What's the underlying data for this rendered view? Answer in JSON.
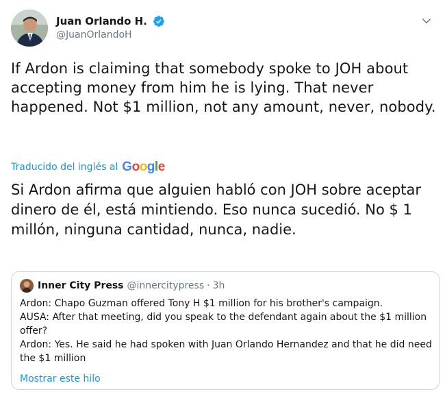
{
  "author": {
    "display_name": "Juan Orlando H.",
    "handle": "@JuanOrlandoH",
    "verified_icon": "verified-badge-icon"
  },
  "tweet": {
    "text": "If Ardon is claiming that somebody spoke to JOH about accepting money from him he is lying. That never happened. Not $1 million, not any amount, never, nobody."
  },
  "translation": {
    "label": "Traducido del inglés al",
    "provider": [
      "G",
      "o",
      "o",
      "g",
      "l",
      "e"
    ],
    "provider_colors": [
      "#4285F4",
      "#EA4335",
      "#FBBC05",
      "#4285F4",
      "#34A853",
      "#EA4335"
    ],
    "text": "Si Ardon afirma que alguien habló con JOH sobre aceptar dinero de él, está mintiendo. Eso nunca sucedió. No $ 1 millón, ninguna cantidad, nunca, nadie."
  },
  "quoted_tweet": {
    "display_name": "Inner City Press",
    "handle": "@innercitypress",
    "separator": "·",
    "time": "3h",
    "lines": [
      "Ardon: Chapo Guzman offered Tony H $1 million for his brother's campaign.",
      "AUSA: After that meeting, did you speak to the defendant again about the $1 million offer?",
      "Ardon: Yes. He said he had spoken with Juan Orlando Hernandez and that he did need the $1 million"
    ],
    "show_thread": "Mostrar este hilo"
  },
  "colors": {
    "link": "#1b95e0",
    "secondary_text": "#657786",
    "primary_text": "#14171a",
    "border": "#ccd6dd",
    "verified": "#1da1f2"
  }
}
